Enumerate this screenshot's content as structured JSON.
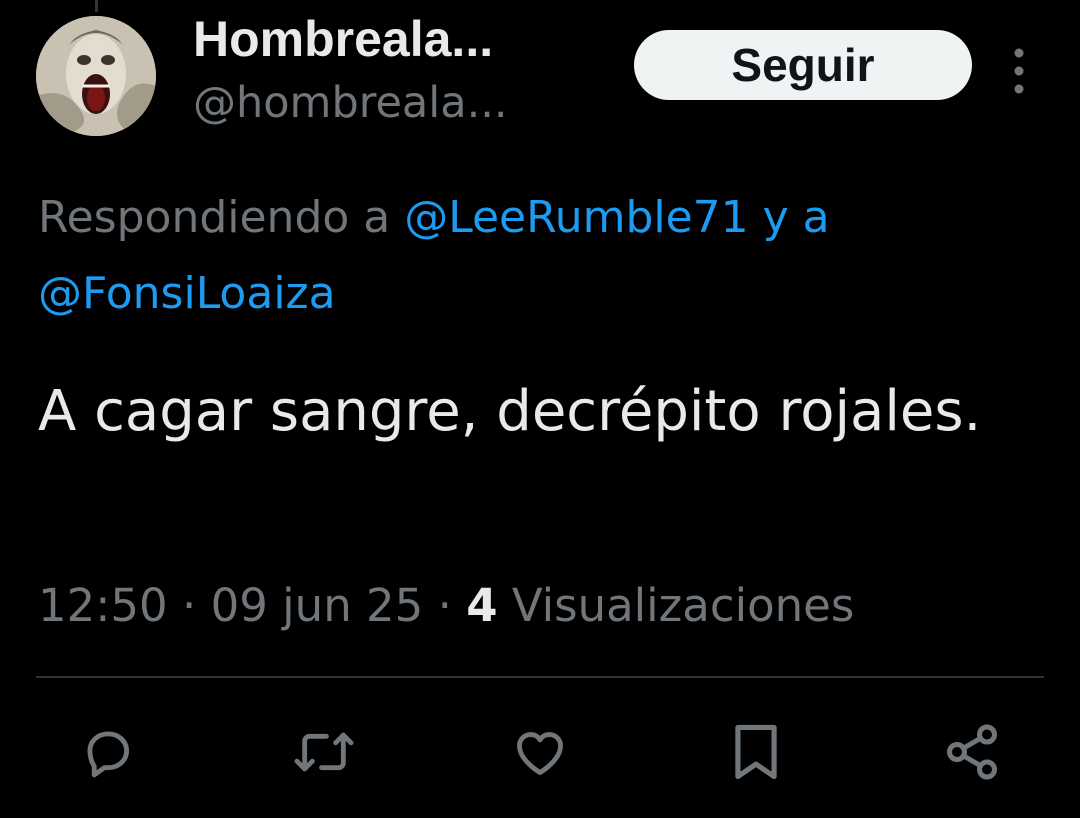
{
  "user": {
    "display_name": "Hombreala...",
    "handle": "@hombreala...",
    "avatar_icon": "screaming-face-avatar"
  },
  "follow_button": {
    "label": "Seguir"
  },
  "more_icon": "more-vertical-icon",
  "replying": {
    "prefix": "Respondiendo a ",
    "mention_1": "@LeeRumble71",
    "connector": " y a",
    "mention_2": "@FonsiLoaiza"
  },
  "tweet": {
    "text": "A cagar sangre, decrépito rojales."
  },
  "meta": {
    "time": "12:50",
    "separator_1": " · ",
    "date": "09 jun 25",
    "separator_2": " · ",
    "views_count": "4",
    "views_label": " Visualizaciones"
  },
  "actions": [
    {
      "name": "reply",
      "icon": "comment-icon"
    },
    {
      "name": "retweet",
      "icon": "retweet-icon"
    },
    {
      "name": "like",
      "icon": "heart-icon"
    },
    {
      "name": "bookmark",
      "icon": "bookmark-icon"
    },
    {
      "name": "share",
      "icon": "share-icon"
    }
  ],
  "colors": {
    "background": "#000000",
    "primary_text": "#e7e9ea",
    "secondary_text": "#71767b",
    "accent": "#1d9bf0",
    "divider": "#2f3336",
    "button_bg": "#eff3f4",
    "button_text": "#0f1419"
  }
}
